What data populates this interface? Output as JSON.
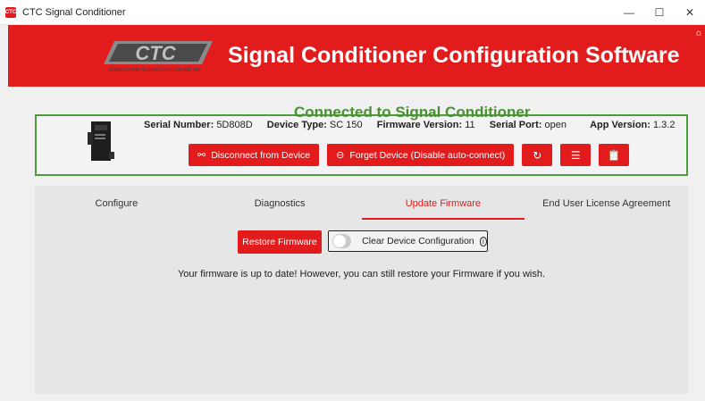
{
  "window": {
    "title": "CTC Signal Conditioner",
    "app_icon_text": "CTC",
    "minimize": "—",
    "maximize": "☐",
    "close": "✕"
  },
  "header": {
    "title": "Signal Conditioner Configuration Software",
    "logo_text": "CTC",
    "logo_subtext": "CONNECTION TECHNOLOGY CENTER, INC.",
    "accent_color": "#e21c1c"
  },
  "connection": {
    "status_title": "Connected to Signal Conditioner",
    "status_color": "#4a9136",
    "serial_number_label": "Serial Number:",
    "serial_number_value": "5D808D",
    "device_type_label": "Device Type:",
    "device_type_value": "SC 150",
    "firmware_label": "Firmware Version:",
    "firmware_value": "11",
    "serial_port_label": "Serial Port:",
    "serial_port_value": "open",
    "app_version_label": "App Version:",
    "app_version_value": "1.3.2",
    "buttons": {
      "disconnect": "Disconnect from Device",
      "forget": "Forget Device (Disable auto-connect)"
    },
    "icons": {
      "disconnect": "unplug-icon",
      "forget": "minus-circle-icon",
      "refresh": "refresh-icon",
      "list": "list-icon",
      "clipboard": "clipboard-icon"
    }
  },
  "tabs": [
    {
      "label": "Configure"
    },
    {
      "label": "Diagnostics"
    },
    {
      "label": "Update Firmware"
    },
    {
      "label": "End User License Agreement"
    }
  ],
  "active_tab": "Update Firmware",
  "firmware": {
    "restore_button": "Restore Firmware",
    "clear_config_label": "Clear Device Configuration",
    "clear_config_enabled": false,
    "message": "Your firmware is up to date! However, you can still restore your Firmware if you wish."
  }
}
